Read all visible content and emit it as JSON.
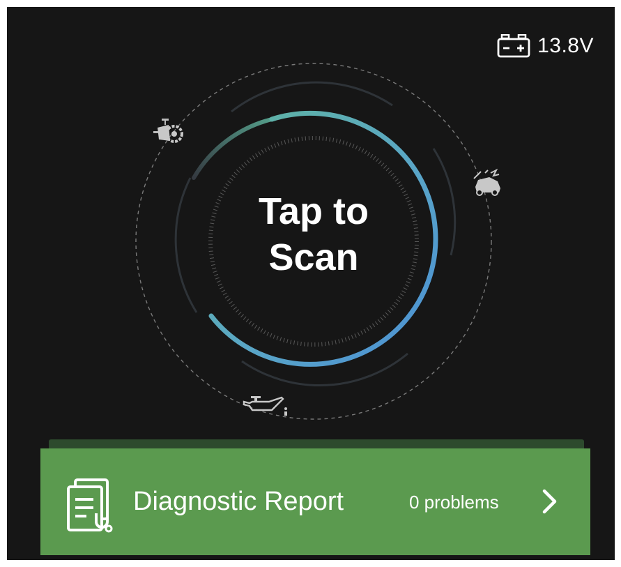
{
  "status_bar": {
    "battery_icon": "car-battery-icon",
    "battery_voltage": "13.8V"
  },
  "scan": {
    "label_line1": "Tap to",
    "label_line2": "Scan",
    "ring_icons": [
      "engine-turbo-icon",
      "car-crash-icon",
      "oil-can-icon"
    ],
    "gradient_colors": [
      "#4a5560",
      "#5fb59e",
      "#5aa6c6",
      "#4a8fd6"
    ]
  },
  "report": {
    "icon": "report-stethoscope-icon",
    "title": "Diagnostic Report",
    "problem_count": "0 problems",
    "chevron_icon": "chevron-right-icon",
    "background_color": "#5b9a4f"
  }
}
